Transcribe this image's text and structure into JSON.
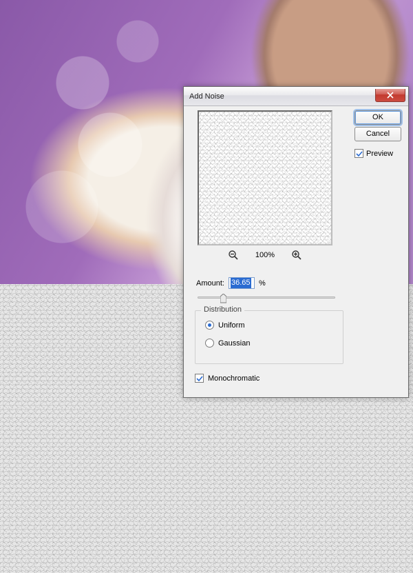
{
  "dialog": {
    "title": "Add Noise",
    "ok": "OK",
    "cancel": "Cancel",
    "preview_label": "Preview",
    "preview_checked": true,
    "zoom_label": "100%",
    "amount_label": "Amount:",
    "amount_value": "36.65",
    "amount_unit": "%",
    "distribution_label": "Distribution",
    "radio_uniform": "Uniform",
    "radio_gaussian": "Gaussian",
    "distribution_selected": "uniform",
    "mono_label": "Monochromatic",
    "mono_checked": true
  }
}
